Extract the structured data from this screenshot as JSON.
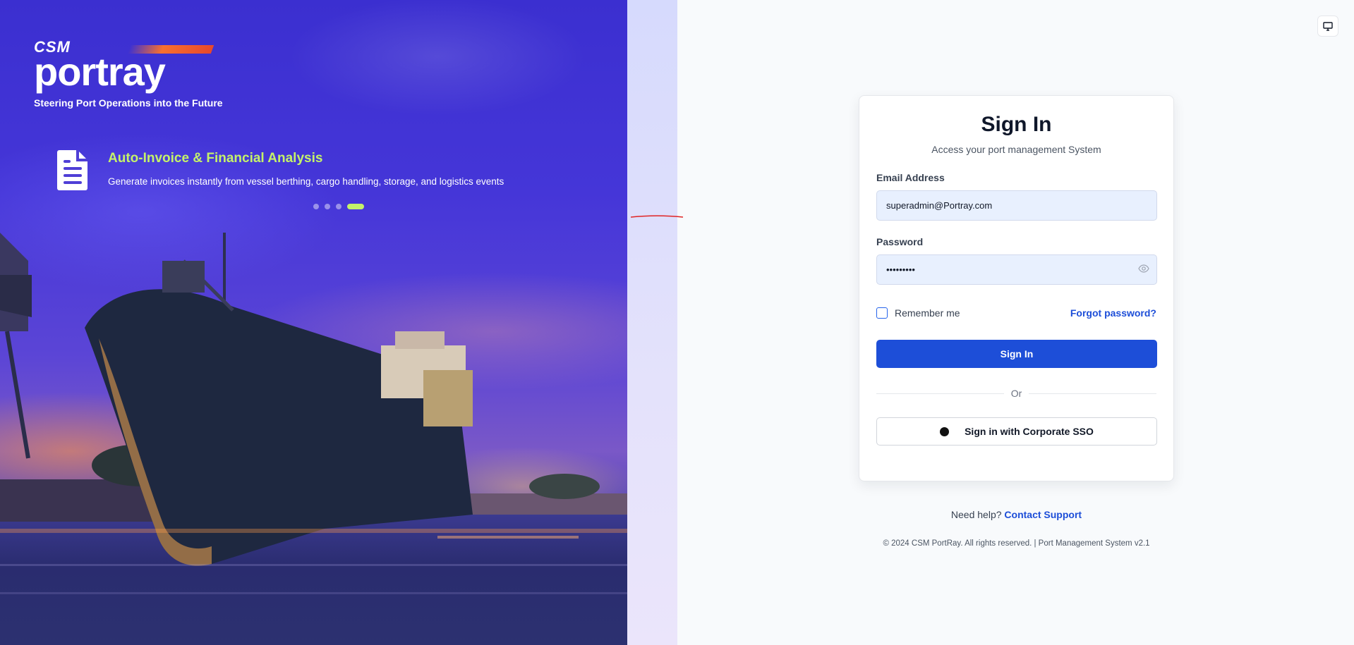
{
  "brand": {
    "logo_csm": "CSM",
    "logo_name": "portray",
    "tagline": "Steering Port Operations into the Future"
  },
  "feature": {
    "icon": "document-icon",
    "title": "Auto-Invoice & Financial Analysis",
    "description": "Generate invoices instantly from vessel berthing, cargo handling, storage, and logistics events"
  },
  "carousel": {
    "count": 4,
    "active_index": 3
  },
  "theme_toggle": {
    "icon": "monitor-icon"
  },
  "signin": {
    "title": "Sign In",
    "subtitle": "Access your port management System",
    "email_label": "Email Address",
    "email_value": "superadmin@Portray.com",
    "password_label": "Password",
    "password_masked": "•••••••••",
    "remember_label": "Remember me",
    "forgot_label": "Forgot password?",
    "submit_label": "Sign In",
    "or_label": "Or",
    "sso_label": "Sign in with Corporate SSO"
  },
  "help": {
    "prefix": "Need help?",
    "link": "Contact Support"
  },
  "footer": {
    "text": "© 2024 CSM PortRay. All rights reserved. | Port Management System v2.1"
  },
  "colors": {
    "accent": "#1d4ed8",
    "highlight": "#c4f26a",
    "hero": "#4536d8"
  }
}
